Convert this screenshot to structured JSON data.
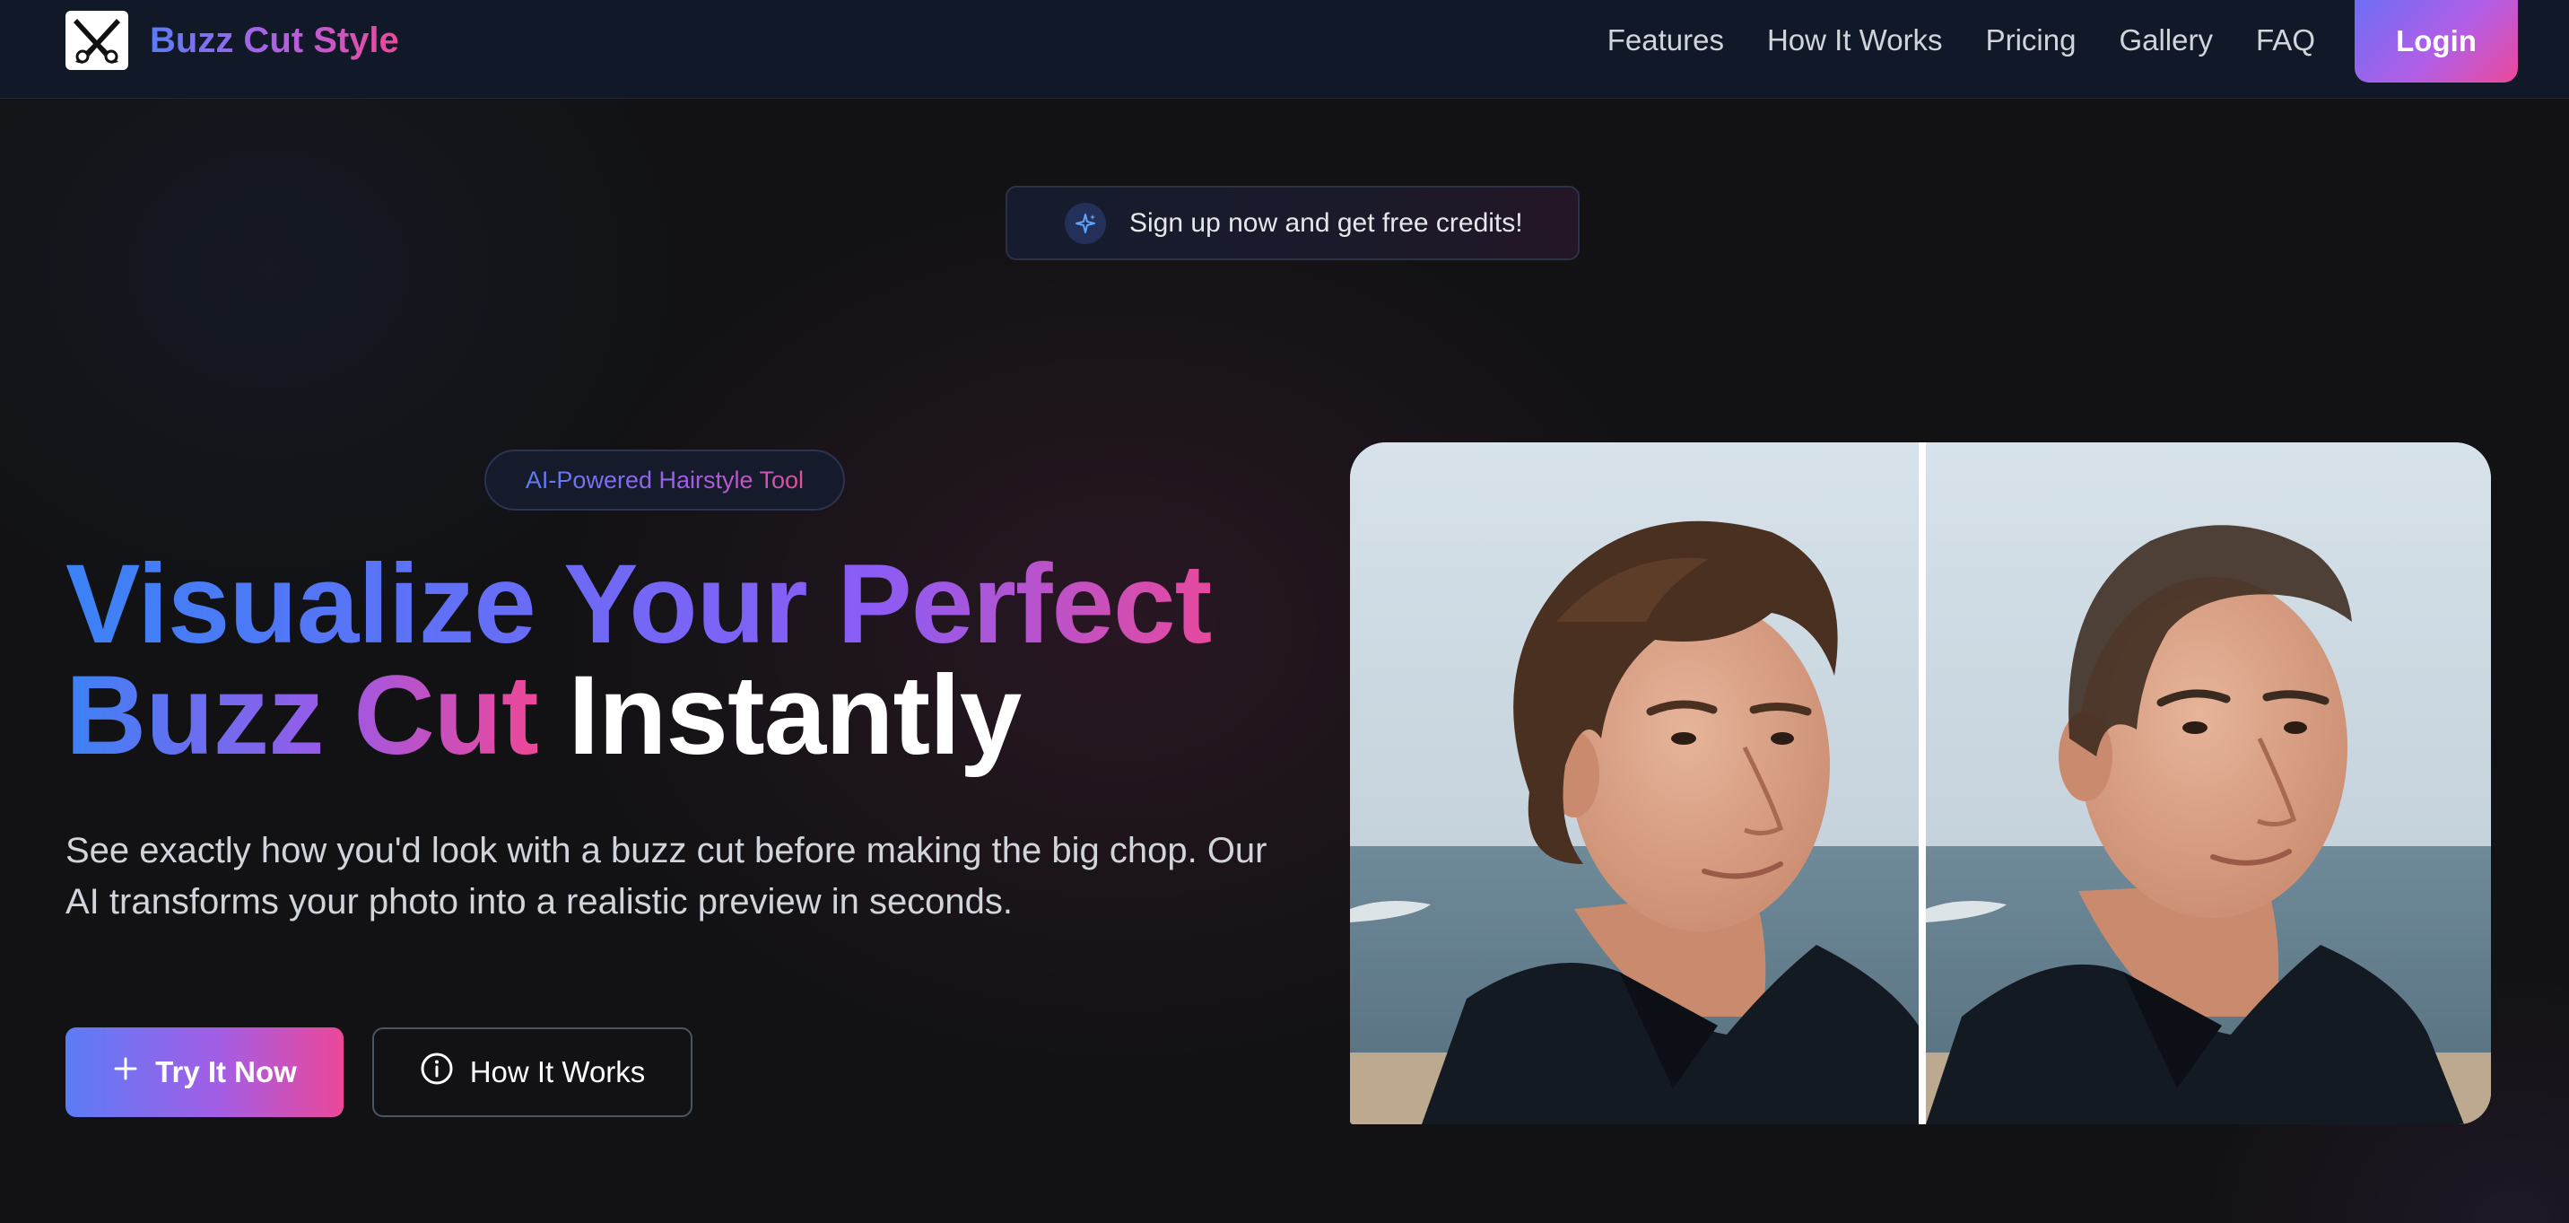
{
  "brand": {
    "name": "Buzz Cut Style",
    "logo_icon": "scissors-logo-icon"
  },
  "nav": {
    "links": [
      "Features",
      "How It Works",
      "Pricing",
      "Gallery",
      "FAQ"
    ],
    "login_label": "Login"
  },
  "announcement": {
    "icon": "sparkle-icon",
    "text": "Sign up now and get free credits!"
  },
  "hero": {
    "badge": "AI-Powered Hairstyle Tool",
    "headline": {
      "line1": "Visualize Your Perfect",
      "line2_gradient": "Buzz Cut",
      "line2_plain": "Instantly"
    },
    "subtext": "See exactly how you'd look with a buzz cut before making the big chop. Our AI transforms your photo into a realistic preview in seconds.",
    "primary_button": {
      "label": "Try It Now",
      "icon": "plus-icon"
    },
    "secondary_button": {
      "label": "How It Works",
      "icon": "info-icon"
    },
    "image": {
      "description": "before-after-comparison",
      "before": "man-with-wavy-hair",
      "after": "man-with-buzz-cut"
    }
  },
  "colors": {
    "background": "#121214",
    "nav_background": "#111827",
    "gradient_start": "#3b82f6",
    "gradient_mid": "#8b5cf6",
    "gradient_end": "#ec4899"
  }
}
